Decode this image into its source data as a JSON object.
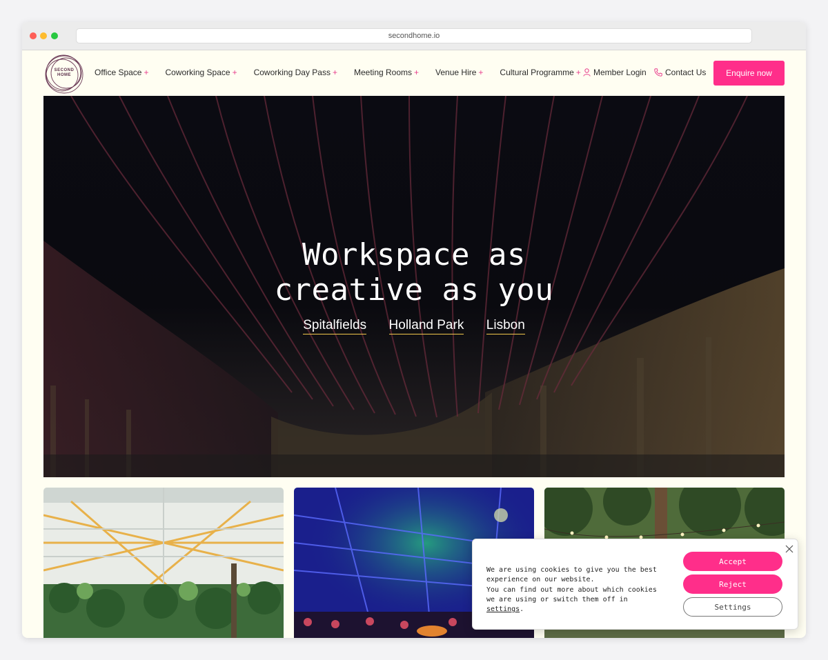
{
  "browser": {
    "url": "secondhome.io"
  },
  "brand": {
    "logo_text_line1": "SECOND",
    "logo_text_line2": "HOME",
    "accent": "#ff2e8a",
    "underline": "#f2c94c",
    "background": "#fffef2"
  },
  "nav": {
    "items": [
      {
        "label": "Office Space",
        "suffix": "+"
      },
      {
        "label": "Coworking Space",
        "suffix": "+"
      },
      {
        "label": "Coworking Day Pass",
        "suffix": "+"
      },
      {
        "label": "Meeting Rooms",
        "suffix": "+"
      },
      {
        "label": "Venue Hire",
        "suffix": "+"
      },
      {
        "label": "Cultural Programme",
        "suffix": "+"
      }
    ],
    "member_login": "Member Login",
    "contact_us": "Contact Us",
    "enquire": "Enquire now"
  },
  "hero": {
    "title_line1": "Workspace as",
    "title_line2": "creative as you",
    "locations": [
      "Spitalfields",
      "Holland Park",
      "Lisbon"
    ]
  },
  "cookie": {
    "line1": "We are using cookies to give you the best experience on our website.",
    "line2": "You can find out more about which cookies we are using or switch them off in",
    "settings_link": "settings",
    "line2_end": ".",
    "accept": "Accept",
    "reject": "Reject",
    "settings": "Settings"
  },
  "icons": {
    "user": "user-icon",
    "phone": "phone-icon",
    "close": "close-icon"
  }
}
